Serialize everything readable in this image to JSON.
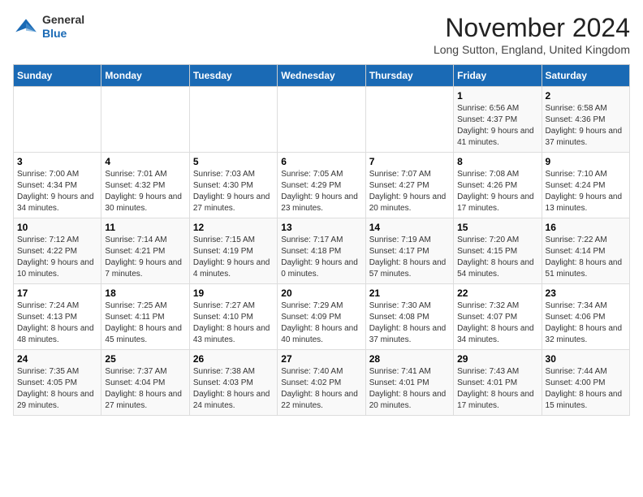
{
  "header": {
    "logo_general": "General",
    "logo_blue": "Blue",
    "month_title": "November 2024",
    "location": "Long Sutton, England, United Kingdom"
  },
  "days_of_week": [
    "Sunday",
    "Monday",
    "Tuesday",
    "Wednesday",
    "Thursday",
    "Friday",
    "Saturday"
  ],
  "weeks": [
    [
      {
        "day": "",
        "detail": ""
      },
      {
        "day": "",
        "detail": ""
      },
      {
        "day": "",
        "detail": ""
      },
      {
        "day": "",
        "detail": ""
      },
      {
        "day": "",
        "detail": ""
      },
      {
        "day": "1",
        "detail": "Sunrise: 6:56 AM\nSunset: 4:37 PM\nDaylight: 9 hours and 41 minutes."
      },
      {
        "day": "2",
        "detail": "Sunrise: 6:58 AM\nSunset: 4:36 PM\nDaylight: 9 hours and 37 minutes."
      }
    ],
    [
      {
        "day": "3",
        "detail": "Sunrise: 7:00 AM\nSunset: 4:34 PM\nDaylight: 9 hours and 34 minutes."
      },
      {
        "day": "4",
        "detail": "Sunrise: 7:01 AM\nSunset: 4:32 PM\nDaylight: 9 hours and 30 minutes."
      },
      {
        "day": "5",
        "detail": "Sunrise: 7:03 AM\nSunset: 4:30 PM\nDaylight: 9 hours and 27 minutes."
      },
      {
        "day": "6",
        "detail": "Sunrise: 7:05 AM\nSunset: 4:29 PM\nDaylight: 9 hours and 23 minutes."
      },
      {
        "day": "7",
        "detail": "Sunrise: 7:07 AM\nSunset: 4:27 PM\nDaylight: 9 hours and 20 minutes."
      },
      {
        "day": "8",
        "detail": "Sunrise: 7:08 AM\nSunset: 4:26 PM\nDaylight: 9 hours and 17 minutes."
      },
      {
        "day": "9",
        "detail": "Sunrise: 7:10 AM\nSunset: 4:24 PM\nDaylight: 9 hours and 13 minutes."
      }
    ],
    [
      {
        "day": "10",
        "detail": "Sunrise: 7:12 AM\nSunset: 4:22 PM\nDaylight: 9 hours and 10 minutes."
      },
      {
        "day": "11",
        "detail": "Sunrise: 7:14 AM\nSunset: 4:21 PM\nDaylight: 9 hours and 7 minutes."
      },
      {
        "day": "12",
        "detail": "Sunrise: 7:15 AM\nSunset: 4:19 PM\nDaylight: 9 hours and 4 minutes."
      },
      {
        "day": "13",
        "detail": "Sunrise: 7:17 AM\nSunset: 4:18 PM\nDaylight: 9 hours and 0 minutes."
      },
      {
        "day": "14",
        "detail": "Sunrise: 7:19 AM\nSunset: 4:17 PM\nDaylight: 8 hours and 57 minutes."
      },
      {
        "day": "15",
        "detail": "Sunrise: 7:20 AM\nSunset: 4:15 PM\nDaylight: 8 hours and 54 minutes."
      },
      {
        "day": "16",
        "detail": "Sunrise: 7:22 AM\nSunset: 4:14 PM\nDaylight: 8 hours and 51 minutes."
      }
    ],
    [
      {
        "day": "17",
        "detail": "Sunrise: 7:24 AM\nSunset: 4:13 PM\nDaylight: 8 hours and 48 minutes."
      },
      {
        "day": "18",
        "detail": "Sunrise: 7:25 AM\nSunset: 4:11 PM\nDaylight: 8 hours and 45 minutes."
      },
      {
        "day": "19",
        "detail": "Sunrise: 7:27 AM\nSunset: 4:10 PM\nDaylight: 8 hours and 43 minutes."
      },
      {
        "day": "20",
        "detail": "Sunrise: 7:29 AM\nSunset: 4:09 PM\nDaylight: 8 hours and 40 minutes."
      },
      {
        "day": "21",
        "detail": "Sunrise: 7:30 AM\nSunset: 4:08 PM\nDaylight: 8 hours and 37 minutes."
      },
      {
        "day": "22",
        "detail": "Sunrise: 7:32 AM\nSunset: 4:07 PM\nDaylight: 8 hours and 34 minutes."
      },
      {
        "day": "23",
        "detail": "Sunrise: 7:34 AM\nSunset: 4:06 PM\nDaylight: 8 hours and 32 minutes."
      }
    ],
    [
      {
        "day": "24",
        "detail": "Sunrise: 7:35 AM\nSunset: 4:05 PM\nDaylight: 8 hours and 29 minutes."
      },
      {
        "day": "25",
        "detail": "Sunrise: 7:37 AM\nSunset: 4:04 PM\nDaylight: 8 hours and 27 minutes."
      },
      {
        "day": "26",
        "detail": "Sunrise: 7:38 AM\nSunset: 4:03 PM\nDaylight: 8 hours and 24 minutes."
      },
      {
        "day": "27",
        "detail": "Sunrise: 7:40 AM\nSunset: 4:02 PM\nDaylight: 8 hours and 22 minutes."
      },
      {
        "day": "28",
        "detail": "Sunrise: 7:41 AM\nSunset: 4:01 PM\nDaylight: 8 hours and 20 minutes."
      },
      {
        "day": "29",
        "detail": "Sunrise: 7:43 AM\nSunset: 4:01 PM\nDaylight: 8 hours and 17 minutes."
      },
      {
        "day": "30",
        "detail": "Sunrise: 7:44 AM\nSunset: 4:00 PM\nDaylight: 8 hours and 15 minutes."
      }
    ]
  ]
}
